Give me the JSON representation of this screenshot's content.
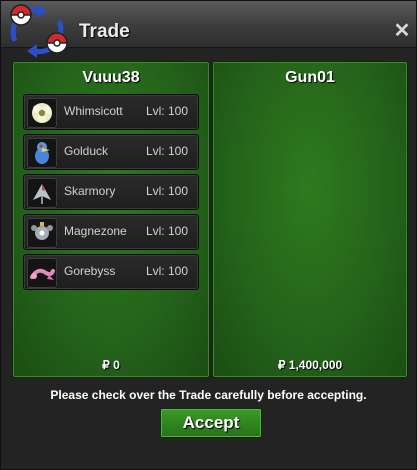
{
  "window": {
    "title": "Trade",
    "close_label": "✕"
  },
  "left": {
    "player": "Vuuu38",
    "money": "₽ 0",
    "pokemon": [
      {
        "name": "Whimsicott",
        "level": "Lvl: 100",
        "icon": "whimsicott-icon"
      },
      {
        "name": "Golduck",
        "level": "Lvl: 100",
        "icon": "golduck-icon"
      },
      {
        "name": "Skarmory",
        "level": "Lvl: 100",
        "icon": "skarmory-icon"
      },
      {
        "name": "Magnezone",
        "level": "Lvl: 100",
        "icon": "magnezone-icon"
      },
      {
        "name": "Gorebyss",
        "level": "Lvl: 100",
        "icon": "gorebyss-icon"
      }
    ]
  },
  "right": {
    "player": "Gun01",
    "money": "₽ 1,400,000",
    "pokemon": []
  },
  "footer": {
    "message": "Please check over the Trade carefully before accepting.",
    "accept_label": "Accept"
  },
  "colors": {
    "panel_green": "#2f7a1e",
    "accept_green": "#3d9a26",
    "pokeball_red": "#d22a2a",
    "arrow_blue": "#2a4fc8"
  }
}
